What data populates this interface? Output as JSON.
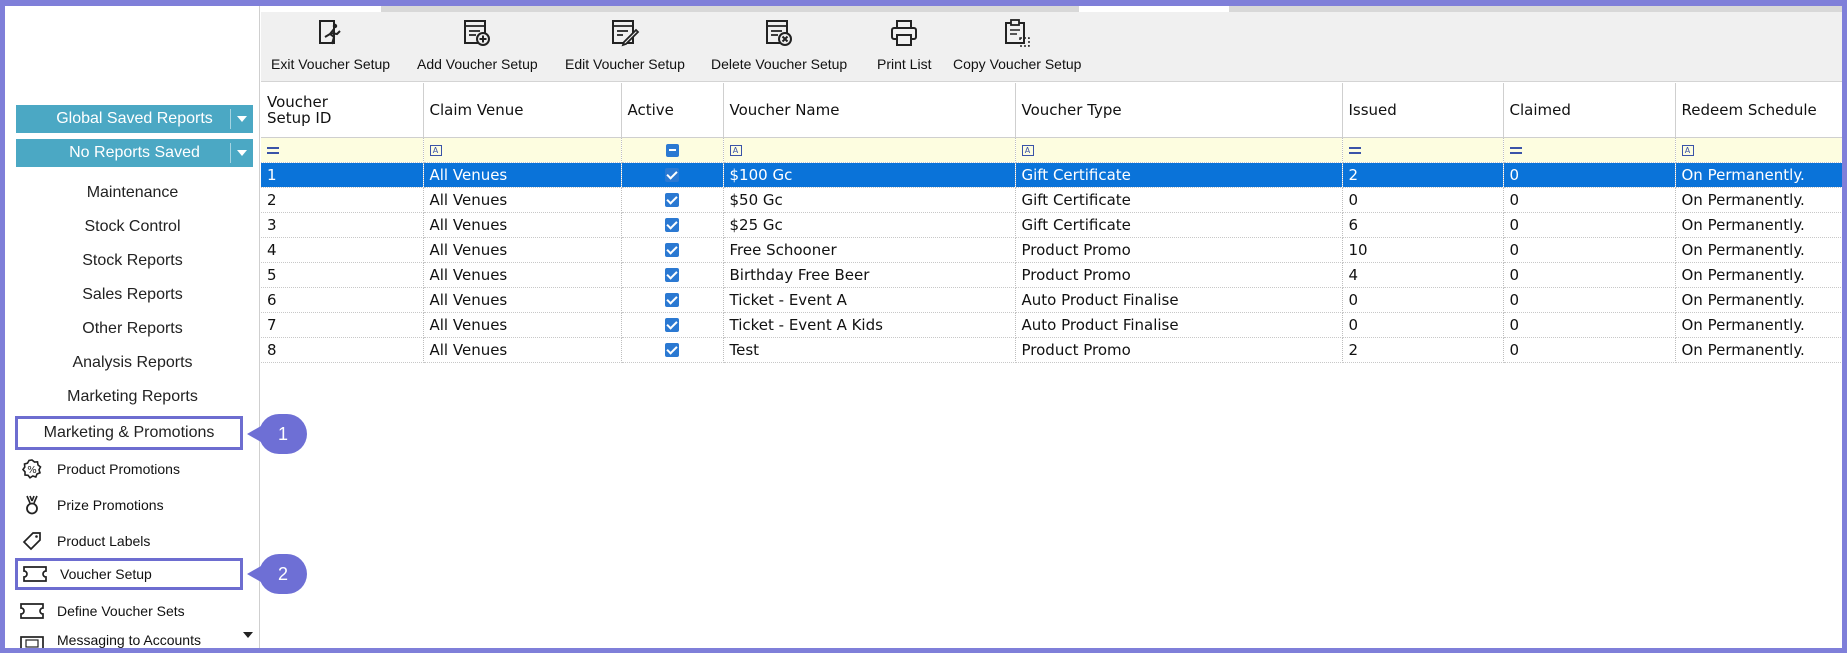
{
  "toolbar": {
    "buttons": [
      {
        "label": "Exit Voucher Setup",
        "icon": "exit-runner-icon"
      },
      {
        "label": "Add Voucher Setup",
        "icon": "add-document-icon"
      },
      {
        "label": "Edit Voucher Setup",
        "icon": "edit-document-icon"
      },
      {
        "label": "Delete Voucher Setup",
        "icon": "delete-document-icon"
      },
      {
        "label": "Print List",
        "icon": "printer-icon"
      },
      {
        "label": "Copy Voucher Setup",
        "icon": "copy-clipboard-icon"
      }
    ]
  },
  "sidebar": {
    "dropdown_global": "Global Saved Reports",
    "dropdown_reports": "No Reports Saved",
    "nav": [
      {
        "label": "Maintenance"
      },
      {
        "label": "Stock Control"
      },
      {
        "label": "Stock Reports"
      },
      {
        "label": "Sales Reports"
      },
      {
        "label": "Other Reports"
      },
      {
        "label": "Analysis Reports"
      },
      {
        "label": "Marketing Reports"
      },
      {
        "label": "Marketing & Promotions"
      }
    ],
    "sub": [
      {
        "label": "Product Promotions",
        "icon": "percent-badge-icon"
      },
      {
        "label": "Prize Promotions",
        "icon": "medal-icon"
      },
      {
        "label": "Product Labels",
        "icon": "tag-icon"
      },
      {
        "label": "Voucher Setup",
        "icon": "ticket-icon"
      },
      {
        "label": "Define Voucher Sets",
        "icon": "ticket-icon"
      },
      {
        "label": "Messaging to Accounts",
        "icon": "message-icon"
      }
    ]
  },
  "callouts": {
    "one": "1",
    "two": "2"
  },
  "grid": {
    "columns": [
      "Voucher\nSetup ID",
      "Claim Venue",
      "Active",
      "Voucher Name",
      "Voucher Type",
      "Issued",
      "Claimed",
      "Redeem Schedule"
    ],
    "rows": [
      {
        "id": "1",
        "venue": "All Venues",
        "active": true,
        "name": "$100 Gc",
        "type": "Gift Certificate",
        "issued": "2",
        "claimed": "0",
        "schedule": "On Permanently."
      },
      {
        "id": "2",
        "venue": "All Venues",
        "active": true,
        "name": "$50 Gc",
        "type": "Gift Certificate",
        "issued": "0",
        "claimed": "0",
        "schedule": "On Permanently."
      },
      {
        "id": "3",
        "venue": "All Venues",
        "active": true,
        "name": "$25 Gc",
        "type": "Gift Certificate",
        "issued": "6",
        "claimed": "0",
        "schedule": "On Permanently."
      },
      {
        "id": "4",
        "venue": "All Venues",
        "active": true,
        "name": "Free Schooner",
        "type": "Product Promo",
        "issued": "10",
        "claimed": "0",
        "schedule": "On Permanently."
      },
      {
        "id": "5",
        "venue": "All Venues",
        "active": true,
        "name": "Birthday Free Beer",
        "type": "Product Promo",
        "issued": "4",
        "claimed": "0",
        "schedule": "On Permanently."
      },
      {
        "id": "6",
        "venue": "All Venues",
        "active": true,
        "name": "Ticket - Event A",
        "type": "Auto Product Finalise",
        "issued": "0",
        "claimed": "0",
        "schedule": "On Permanently."
      },
      {
        "id": "7",
        "venue": "All Venues",
        "active": true,
        "name": "Ticket - Event A Kids",
        "type": "Auto Product Finalise",
        "issued": "0",
        "claimed": "0",
        "schedule": "On Permanently."
      },
      {
        "id": "8",
        "venue": "All Venues",
        "active": true,
        "name": "Test",
        "type": "Product Promo",
        "issued": "2",
        "claimed": "0",
        "schedule": "On Permanently."
      }
    ],
    "selected_row": "1"
  },
  "colors": {
    "accent": "#4ba8c4",
    "selection": "#0a73d9",
    "callout": "#6e6fd5",
    "frame": "#7f7fd9"
  }
}
